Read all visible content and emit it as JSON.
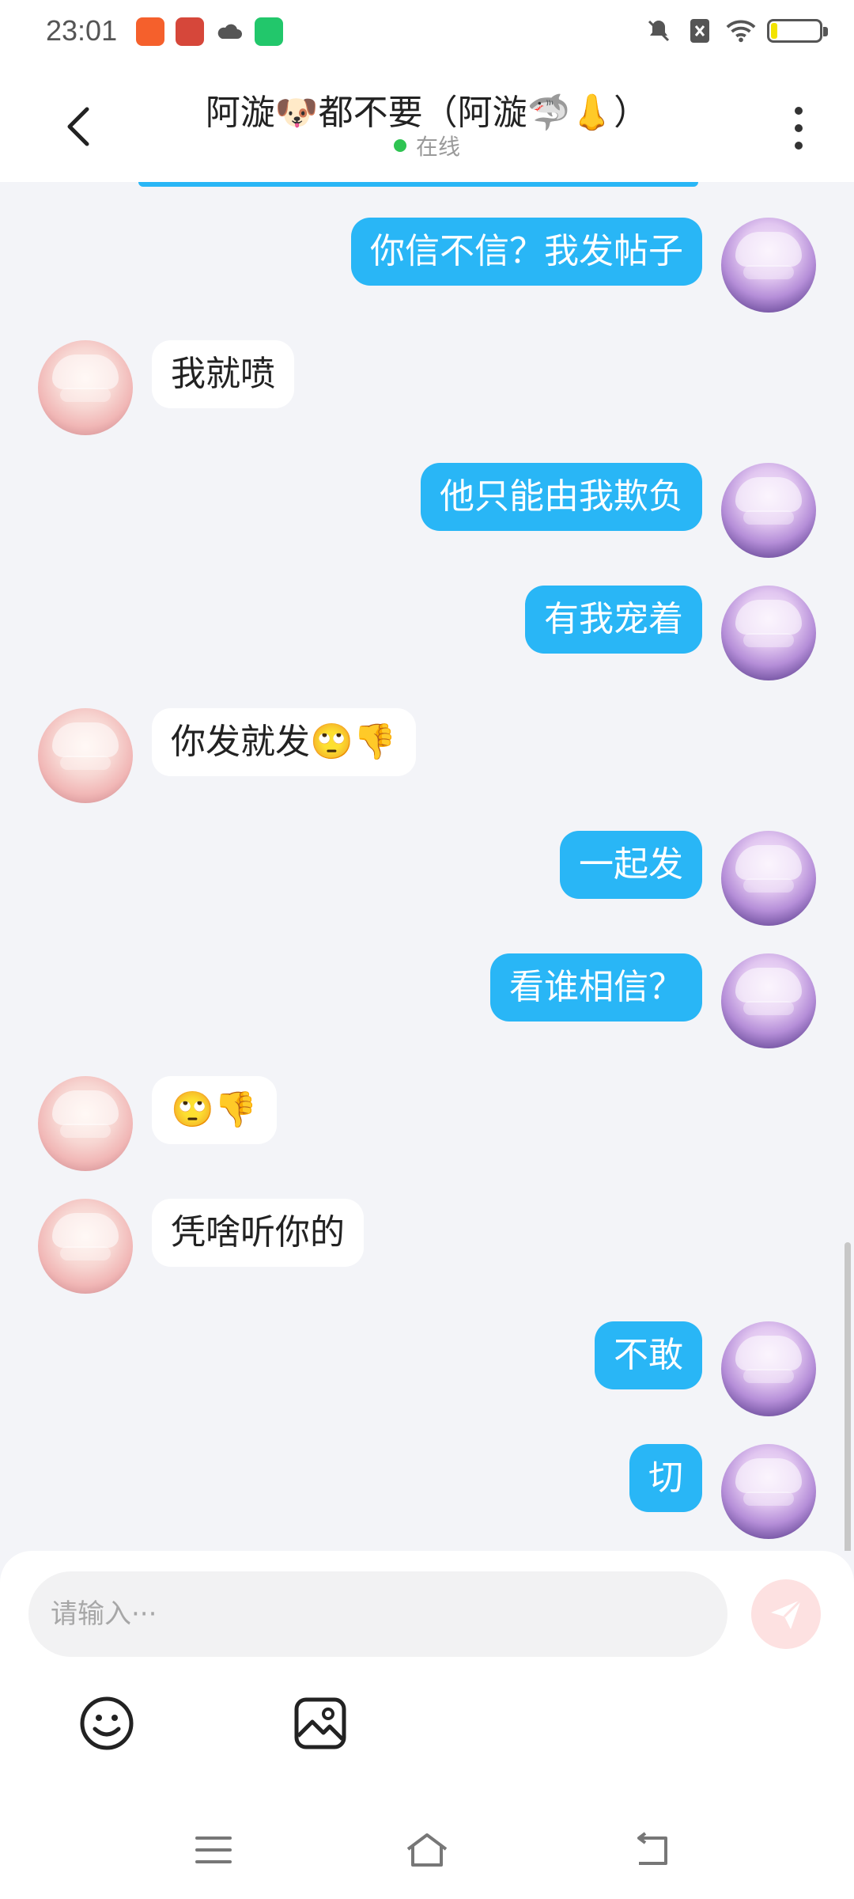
{
  "status_bar": {
    "time": "23:01",
    "app_icons": [
      {
        "name": "kuaishou-icon",
        "color": "#f5602c"
      },
      {
        "name": "xiaohongshu-icon",
        "color": "#d6473a"
      },
      {
        "name": "cloud-icon",
        "color": "#555555"
      },
      {
        "name": "iqiyi-icon",
        "color": "#22c76b"
      }
    ],
    "system_icons": [
      "mute-icon",
      "no-sim-icon",
      "wifi-icon",
      "battery-icon"
    ],
    "battery_color": "#f2e300"
  },
  "header": {
    "title": "阿漩🐶都不要（阿漩🦈👃）",
    "presence": "在线",
    "presence_color": "#2fc452"
  },
  "messages": [
    {
      "side": "right",
      "text": "你信不信？我发帖子"
    },
    {
      "side": "left",
      "text": "我就喷"
    },
    {
      "side": "right",
      "text": "他只能由我欺负"
    },
    {
      "side": "right",
      "text": "有我宠着"
    },
    {
      "side": "left",
      "text": "你发就发🙄👎"
    },
    {
      "side": "right",
      "text": "一起发"
    },
    {
      "side": "right",
      "text": "看谁相信？"
    },
    {
      "side": "left",
      "text": "🙄👎"
    },
    {
      "side": "left",
      "text": "凭啥听你的"
    },
    {
      "side": "right",
      "text": "不敢"
    },
    {
      "side": "right",
      "text": "切"
    }
  ],
  "composer": {
    "placeholder": "请输入···",
    "send_icon": "send-icon",
    "tools": [
      "emoji-icon",
      "image-icon"
    ]
  },
  "navbar": {
    "items": [
      "menu-icon",
      "home-icon",
      "back-icon"
    ]
  },
  "colors": {
    "accent": "#29b6f6",
    "background": "#f3f4f8",
    "send_button_bg": "#fde1e1"
  }
}
